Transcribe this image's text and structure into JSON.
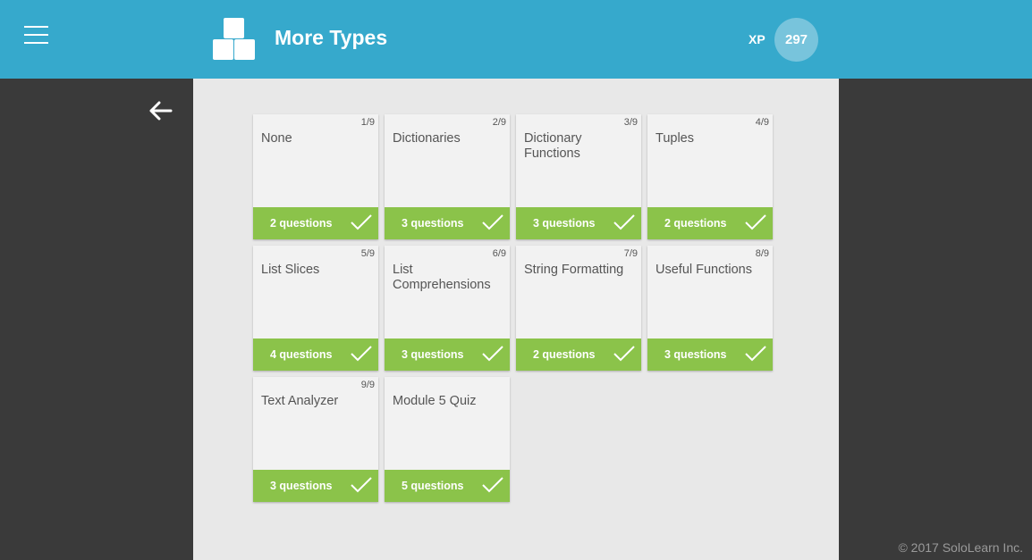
{
  "header": {
    "title": "More Types",
    "xp_label": "XP",
    "xp_value": "297",
    "icons": {
      "menu": "hamburger-menu-icon",
      "logo": "stacked-blocks-icon",
      "back": "arrow-left-icon",
      "complete": "checkmark-icon"
    }
  },
  "lessons": [
    {
      "num": "1/9",
      "name": "None",
      "questions": "2 questions",
      "completed": true
    },
    {
      "num": "2/9",
      "name": "Dictionaries",
      "questions": "3 questions",
      "completed": true
    },
    {
      "num": "3/9",
      "name": "Dictionary Functions",
      "questions": "3 questions",
      "completed": true
    },
    {
      "num": "4/9",
      "name": "Tuples",
      "questions": "2 questions",
      "completed": true
    },
    {
      "num": "5/9",
      "name": "List Slices",
      "questions": "4 questions",
      "completed": true
    },
    {
      "num": "6/9",
      "name": "List Comprehensions",
      "questions": "3 questions",
      "completed": true
    },
    {
      "num": "7/9",
      "name": "String Formatting",
      "questions": "2 questions",
      "completed": true
    },
    {
      "num": "8/9",
      "name": "Useful Functions",
      "questions": "3 questions",
      "completed": true
    },
    {
      "num": "9/9",
      "name": "Text Analyzer",
      "questions": "3 questions",
      "completed": true
    },
    {
      "num": "",
      "name": "Module 5 Quiz",
      "questions": "5 questions",
      "completed": true
    }
  ],
  "footer": {
    "copyright": "© 2017 SoloLearn Inc."
  },
  "colors": {
    "header": "#36a9cc",
    "complete": "#8bc34a"
  }
}
